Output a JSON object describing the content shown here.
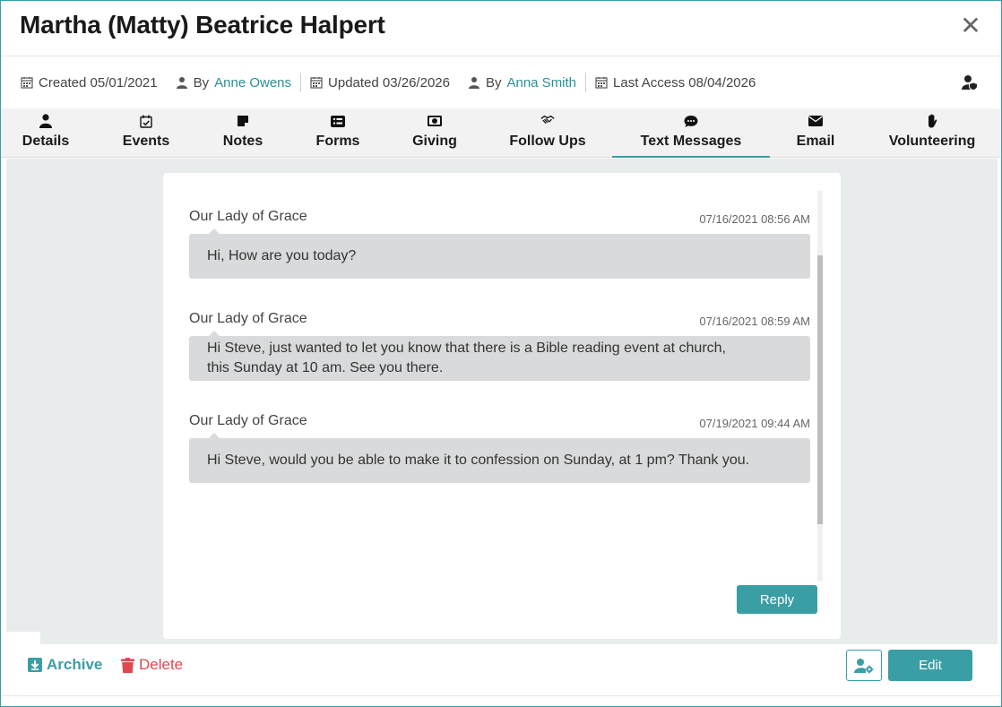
{
  "header": {
    "title": "Martha (Matty) Beatrice Halpert",
    "close_symbol": "✕"
  },
  "meta": {
    "created": "Created 05/01/2021",
    "by_1_prefix": "By",
    "by_1_name": "Anne Owens",
    "updated": "Updated 03/26/2026",
    "by_2_prefix": "By",
    "by_2_name": "Anna Smith",
    "last_access": "Last Access 08/04/2026"
  },
  "tabs": [
    {
      "label": "Details",
      "icon": "person-icon"
    },
    {
      "label": "Events",
      "icon": "calendar-check-icon"
    },
    {
      "label": "Notes",
      "icon": "note-icon"
    },
    {
      "label": "Forms",
      "icon": "form-icon"
    },
    {
      "label": "Giving",
      "icon": "money-icon"
    },
    {
      "label": "Follow Ups",
      "icon": "handshake-icon"
    },
    {
      "label": "Text Messages",
      "icon": "chat-icon"
    },
    {
      "label": "Email",
      "icon": "envelope-icon"
    },
    {
      "label": "Volunteering",
      "icon": "hand-icon"
    }
  ],
  "active_tab": "Text Messages",
  "messages": [
    {
      "sender": "Our Lady of Grace",
      "time": "07/16/2021 08:56 AM",
      "text": "Hi, How are you today?"
    },
    {
      "sender": "Our Lady of Grace",
      "time": "07/16/2021 08:59 AM",
      "text": "Hi Steve, just wanted to let you know that there is a Bible reading event at church,\nthis Sunday at 10 am. See you there."
    },
    {
      "sender": "Our Lady of Grace",
      "time": "07/19/2021 09:44 AM",
      "text": "Hi Steve, would you be able to make it to confession on Sunday, at 1 pm? Thank you."
    }
  ],
  "reply_label": "Reply",
  "footer": {
    "archive_label": "Archive",
    "delete_label": "Delete",
    "edit_label": "Edit"
  },
  "colors": {
    "accent": "#3a9ea5",
    "danger": "#e0484f",
    "bubble": "#d9dadb"
  }
}
